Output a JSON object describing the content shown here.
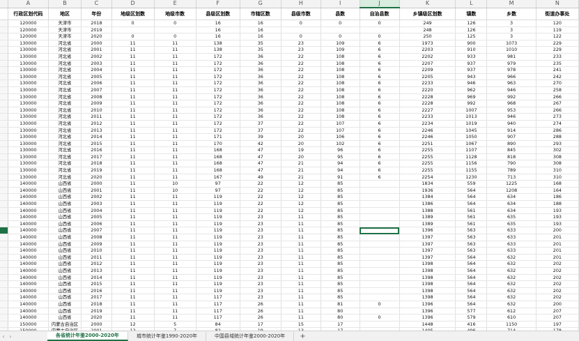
{
  "columns": [
    "A",
    "B",
    "C",
    "D",
    "E",
    "F",
    "G",
    "H",
    "I",
    "J",
    "K",
    "L",
    "M",
    "N"
  ],
  "active_column": "J",
  "headers": [
    "行政区划代码",
    "地区",
    "年份",
    "地级区划数",
    "地级市数",
    "县级区划数",
    "市辖区数",
    "县级市数",
    "县数",
    "自治县数",
    "乡镇级区划数",
    "镇数",
    "乡数",
    "街道办事处"
  ],
  "rows": [
    [
      "120000",
      "天津市",
      "2018",
      "0",
      "0",
      "16",
      "16",
      "0",
      "0",
      "0",
      "249",
      "126",
      "3",
      "120"
    ],
    [
      "120000",
      "天津市",
      "2019",
      "",
      "",
      "16",
      "16",
      "",
      "",
      "",
      "248",
      "126",
      "3",
      "119"
    ],
    [
      "120000",
      "天津市",
      "2020",
      "0",
      "0",
      "16",
      "16",
      "0",
      "0",
      "0",
      "250",
      "125",
      "3",
      "122"
    ],
    [
      "130000",
      "河北省",
      "2000",
      "11",
      "11",
      "138",
      "35",
      "23",
      "109",
      "6",
      "1973",
      "900",
      "1073",
      "229"
    ],
    [
      "130000",
      "河北省",
      "2001",
      "11",
      "11",
      "138",
      "35",
      "23",
      "109",
      "6",
      "2203",
      "910",
      "1010",
      "229"
    ],
    [
      "130000",
      "河北省",
      "2002",
      "11",
      "11",
      "172",
      "36",
      "22",
      "108",
      "6",
      "2202",
      "933",
      "981",
      "233"
    ],
    [
      "130000",
      "河北省",
      "2003",
      "11",
      "11",
      "172",
      "36",
      "22",
      "108",
      "6",
      "2207",
      "937",
      "979",
      "235"
    ],
    [
      "130000",
      "河北省",
      "2004",
      "11",
      "11",
      "172",
      "36",
      "22",
      "108",
      "6",
      "2209",
      "937",
      "978",
      "241"
    ],
    [
      "130000",
      "河北省",
      "2005",
      "11",
      "11",
      "172",
      "36",
      "22",
      "108",
      "6",
      "2205",
      "943",
      "966",
      "242"
    ],
    [
      "130000",
      "河北省",
      "2006",
      "11",
      "11",
      "172",
      "36",
      "22",
      "108",
      "6",
      "2233",
      "946",
      "963",
      "270"
    ],
    [
      "130000",
      "河北省",
      "2007",
      "11",
      "11",
      "172",
      "36",
      "22",
      "108",
      "6",
      "2220",
      "962",
      "946",
      "258"
    ],
    [
      "130000",
      "河北省",
      "2008",
      "11",
      "11",
      "172",
      "36",
      "22",
      "108",
      "6",
      "2228",
      "969",
      "992",
      "266"
    ],
    [
      "130000",
      "河北省",
      "2009",
      "11",
      "11",
      "172",
      "36",
      "22",
      "108",
      "6",
      "2228",
      "992",
      "968",
      "267"
    ],
    [
      "130000",
      "河北省",
      "2010",
      "11",
      "11",
      "172",
      "36",
      "22",
      "108",
      "6",
      "2227",
      "1007",
      "953",
      "266"
    ],
    [
      "130000",
      "河北省",
      "2011",
      "11",
      "11",
      "172",
      "36",
      "22",
      "108",
      "6",
      "2233",
      "1013",
      "946",
      "273"
    ],
    [
      "130000",
      "河北省",
      "2012",
      "11",
      "11",
      "172",
      "37",
      "22",
      "107",
      "6",
      "2234",
      "1019",
      "940",
      "274"
    ],
    [
      "130000",
      "河北省",
      "2013",
      "11",
      "11",
      "172",
      "37",
      "22",
      "107",
      "6",
      "2246",
      "1045",
      "914",
      "286"
    ],
    [
      "130000",
      "河北省",
      "2014",
      "11",
      "11",
      "171",
      "39",
      "20",
      "106",
      "6",
      "2246",
      "1050",
      "907",
      "288"
    ],
    [
      "130000",
      "河北省",
      "2015",
      "11",
      "11",
      "170",
      "42",
      "20",
      "102",
      "6",
      "2251",
      "1067",
      "890",
      "293"
    ],
    [
      "130000",
      "河北省",
      "2016",
      "11",
      "11",
      "168",
      "47",
      "19",
      "96",
      "6",
      "2255",
      "1107",
      "845",
      "302"
    ],
    [
      "130000",
      "河北省",
      "2017",
      "11",
      "11",
      "168",
      "47",
      "20",
      "95",
      "6",
      "2255",
      "1128",
      "818",
      "308"
    ],
    [
      "130000",
      "河北省",
      "2018",
      "11",
      "11",
      "168",
      "47",
      "21",
      "94",
      "6",
      "2255",
      "1156",
      "790",
      "308"
    ],
    [
      "130000",
      "河北省",
      "2019",
      "11",
      "11",
      "168",
      "47",
      "21",
      "94",
      "6",
      "2255",
      "1155",
      "789",
      "310"
    ],
    [
      "130000",
      "河北省",
      "2020",
      "11",
      "11",
      "167",
      "49",
      "21",
      "91",
      "6",
      "2254",
      "1230",
      "713",
      "310"
    ],
    [
      "140000",
      "山西省",
      "2000",
      "11",
      "10",
      "97",
      "22",
      "12",
      "85",
      "",
      "1834",
      "559",
      "1225",
      "168"
    ],
    [
      "140000",
      "山西省",
      "2001",
      "11",
      "10",
      "97",
      "22",
      "12",
      "85",
      "",
      "1936",
      "564",
      "1208",
      "164"
    ],
    [
      "140000",
      "山西省",
      "2002",
      "11",
      "11",
      "119",
      "22",
      "12",
      "85",
      "",
      "1384",
      "564",
      "634",
      "186"
    ],
    [
      "140000",
      "山西省",
      "2003",
      "11",
      "11",
      "119",
      "22",
      "12",
      "85",
      "",
      "1386",
      "564",
      "634",
      "188"
    ],
    [
      "140000",
      "山西省",
      "2004",
      "11",
      "11",
      "119",
      "22",
      "12",
      "85",
      "",
      "1388",
      "561",
      "634",
      "193"
    ],
    [
      "140000",
      "山西省",
      "2005",
      "11",
      "11",
      "119",
      "23",
      "11",
      "85",
      "",
      "1389",
      "561",
      "635",
      "193"
    ],
    [
      "140000",
      "山西省",
      "2006",
      "11",
      "11",
      "119",
      "23",
      "11",
      "85",
      "",
      "1389",
      "561",
      "635",
      "193"
    ],
    [
      "140000",
      "山西省",
      "2007",
      "11",
      "11",
      "119",
      "23",
      "11",
      "85",
      "",
      "1396",
      "563",
      "633",
      "200"
    ],
    [
      "140000",
      "山西省",
      "2008",
      "11",
      "11",
      "119",
      "23",
      "11",
      "85",
      "",
      "1397",
      "563",
      "633",
      "201"
    ],
    [
      "140000",
      "山西省",
      "2009",
      "11",
      "11",
      "119",
      "23",
      "11",
      "85",
      "",
      "1397",
      "563",
      "633",
      "201"
    ],
    [
      "140000",
      "山西省",
      "2010",
      "11",
      "11",
      "119",
      "23",
      "11",
      "85",
      "",
      "1397",
      "563",
      "633",
      "201"
    ],
    [
      "140000",
      "山西省",
      "2011",
      "11",
      "11",
      "119",
      "23",
      "11",
      "85",
      "",
      "1397",
      "564",
      "632",
      "201"
    ],
    [
      "140000",
      "山西省",
      "2012",
      "11",
      "11",
      "119",
      "23",
      "11",
      "85",
      "",
      "1398",
      "564",
      "632",
      "202"
    ],
    [
      "140000",
      "山西省",
      "2013",
      "11",
      "11",
      "119",
      "23",
      "11",
      "85",
      "",
      "1398",
      "564",
      "632",
      "202"
    ],
    [
      "140000",
      "山西省",
      "2014",
      "11",
      "11",
      "119",
      "23",
      "11",
      "85",
      "",
      "1398",
      "564",
      "632",
      "202"
    ],
    [
      "140000",
      "山西省",
      "2015",
      "11",
      "11",
      "119",
      "23",
      "11",
      "85",
      "",
      "1398",
      "564",
      "632",
      "202"
    ],
    [
      "140000",
      "山西省",
      "2016",
      "11",
      "11",
      "119",
      "23",
      "11",
      "85",
      "",
      "1398",
      "564",
      "632",
      "202"
    ],
    [
      "140000",
      "山西省",
      "2017",
      "11",
      "11",
      "117",
      "23",
      "11",
      "85",
      "",
      "1398",
      "564",
      "632",
      "202"
    ],
    [
      "140000",
      "山西省",
      "2018",
      "11",
      "11",
      "117",
      "26",
      "11",
      "81",
      "0",
      "1396",
      "564",
      "632",
      "200"
    ],
    [
      "140000",
      "山西省",
      "2019",
      "11",
      "11",
      "117",
      "26",
      "11",
      "80",
      "",
      "1396",
      "577",
      "612",
      "207"
    ],
    [
      "140000",
      "山西省",
      "2020",
      "11",
      "11",
      "117",
      "26",
      "11",
      "80",
      "0",
      "1396",
      "579",
      "610",
      "207"
    ],
    [
      "150000",
      "内蒙古自治区",
      "2000",
      "12",
      "5",
      "84",
      "17",
      "15",
      "17",
      "",
      "1448",
      "416",
      "1150",
      "197"
    ],
    [
      "150000",
      "内蒙古自治区",
      "2001",
      "12",
      "7",
      "82",
      "19",
      "13",
      "17",
      "",
      "1405",
      "496",
      "714",
      "178"
    ]
  ],
  "selected_row_index": 31,
  "selected_col_index": 9,
  "sheet_tabs": [
    "各省统计年鉴2000-2020年",
    "城市统计年鉴1990-2020年",
    "中国县域统计年鉴2000-2020年"
  ],
  "active_tab_index": 0,
  "add_tab_label": "+",
  "nav_prev": "‹",
  "nav_next": "›"
}
